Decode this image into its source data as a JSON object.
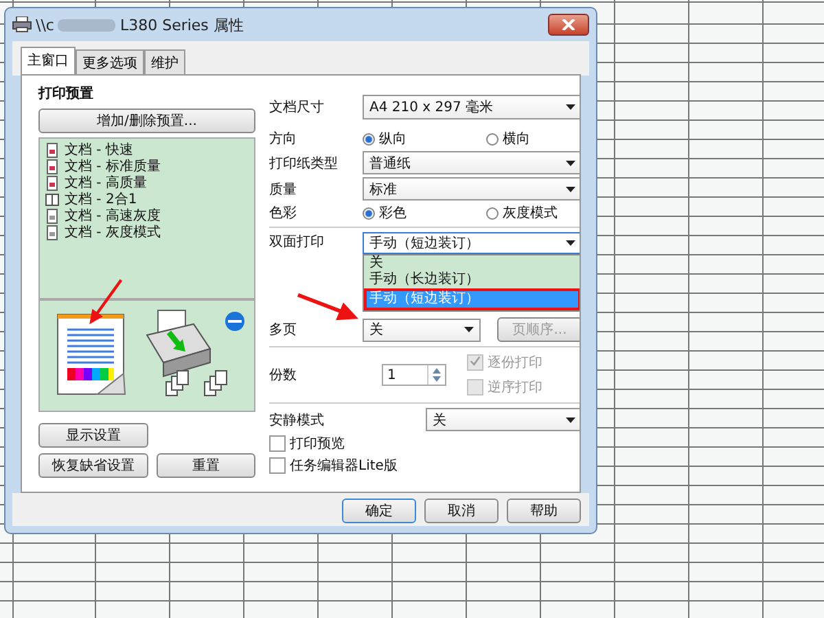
{
  "window": {
    "title_prefix": "\\\\c",
    "title": "L380 Series 属性"
  },
  "tabs": [
    {
      "label": "主窗口",
      "selected": true
    },
    {
      "label": "更多选项",
      "selected": false
    },
    {
      "label": "维护",
      "selected": false
    }
  ],
  "preset": {
    "heading": "打印预置",
    "add_button": "增加/删除预置...",
    "items": [
      {
        "label": "文档 - 快速",
        "kind": "doc"
      },
      {
        "label": "文档 - 标准质量",
        "kind": "doc"
      },
      {
        "label": "文档 - 高质量",
        "kind": "doc"
      },
      {
        "label": "文档 - 2合1",
        "kind": "two-up"
      },
      {
        "label": "文档 - 高速灰度",
        "kind": "gray"
      },
      {
        "label": "文档 - 灰度模式",
        "kind": "gray"
      }
    ]
  },
  "left_buttons": {
    "show_settings": "显示设置",
    "restore_defaults": "恢复缺省设置",
    "reset": "重置"
  },
  "doc_size": {
    "label": "文档尺寸",
    "value": "A4 210 x 297 毫米"
  },
  "orientation": {
    "label": "方向",
    "options": [
      {
        "label": "纵向",
        "selected": true
      },
      {
        "label": "横向",
        "selected": false
      }
    ]
  },
  "paper_type": {
    "label": "打印纸类型",
    "value": "普通纸"
  },
  "quality": {
    "label": "质量",
    "value": "标准"
  },
  "color": {
    "label": "色彩",
    "options": [
      {
        "label": "彩色",
        "selected": true
      },
      {
        "label": "灰度模式",
        "selected": false
      }
    ]
  },
  "duplex": {
    "label": "双面打印",
    "value": "手动（短边装订）",
    "expanded": true,
    "options": [
      {
        "label": "关",
        "selected": false
      },
      {
        "label": "手动（长边装订）",
        "selected": false
      },
      {
        "label": "手动（短边装订）",
        "selected": true
      }
    ]
  },
  "multipage": {
    "label": "多页",
    "value": "关",
    "order_button": {
      "label": "页顺序...",
      "disabled": true
    }
  },
  "copies": {
    "label": "份数",
    "value": "1"
  },
  "collate": {
    "label": "逐份打印",
    "checked": true,
    "disabled": true
  },
  "reverse": {
    "label": "逆序打印",
    "checked": false,
    "disabled": true
  },
  "quiet": {
    "label": "安静模式",
    "value": "关"
  },
  "checkboxes": [
    {
      "label": "打印预览",
      "checked": false
    },
    {
      "label": "任务编辑器Lite版",
      "checked": false
    }
  ],
  "buttons": [
    {
      "label": "确定",
      "default": true
    },
    {
      "label": "取消",
      "default": false
    },
    {
      "label": "帮助",
      "default": false
    }
  ]
}
